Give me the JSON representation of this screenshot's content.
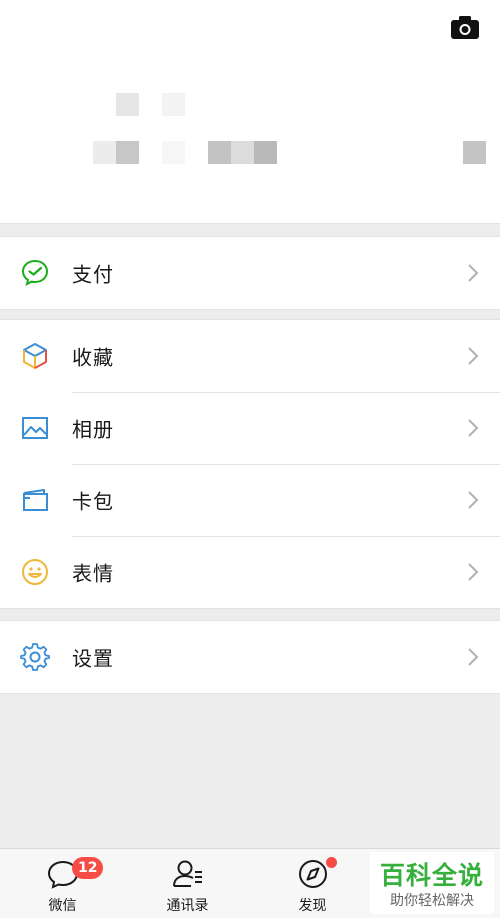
{
  "header": {
    "camera_icon": "camera-icon"
  },
  "menu": {
    "pay": {
      "label": "支付",
      "icon": "wechat-pay-icon",
      "color": "#1aad19"
    },
    "favorites": {
      "label": "收藏",
      "icon": "cube-icon"
    },
    "album": {
      "label": "相册",
      "icon": "picture-icon",
      "color": "#3a8ed6"
    },
    "cards": {
      "label": "卡包",
      "icon": "card-wallet-icon",
      "color": "#3a8ed6"
    },
    "stickers": {
      "label": "表情",
      "icon": "smiley-icon",
      "color": "#f0b73a"
    },
    "settings": {
      "label": "设置",
      "icon": "gear-icon",
      "color": "#3a8ed6"
    }
  },
  "tabbar": {
    "chats": {
      "label": "微信",
      "badge": "12"
    },
    "contacts": {
      "label": "通讯录"
    },
    "discover": {
      "label": "发现"
    }
  },
  "watermark": {
    "title": "百科全说",
    "subtitle": "助你轻松解决"
  },
  "colors": {
    "badge": "#f74c45",
    "background": "#ededed",
    "watermark": "#36b03c"
  }
}
